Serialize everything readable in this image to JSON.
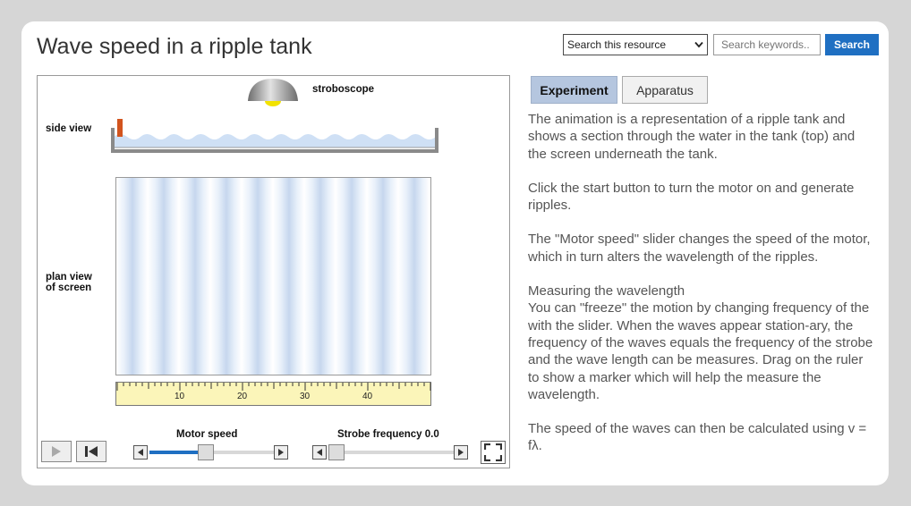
{
  "header": {
    "title": "Wave speed in a ripple tank",
    "search_select": "Search this resource",
    "search_placeholder": "Search keywords..",
    "search_button": "Search"
  },
  "simulation": {
    "stroboscope_label": "stroboscope",
    "side_view_label": "side view",
    "plan_view_label_1": "plan view",
    "plan_view_label_2": "of screen",
    "ruler_labels": [
      "10",
      "20",
      "30",
      "40"
    ],
    "motor_speed_label": "Motor speed",
    "strobe_frequency_label": "Strobe frequency 0.0",
    "motor_speed_level": 0.45,
    "strobe_frequency_level": 0.0
  },
  "tabs": [
    {
      "label": "Experiment",
      "active": true
    },
    {
      "label": "Apparatus",
      "active": false
    }
  ],
  "description": {
    "p1": "The animation is a representation of a ripple tank and shows a section through the water in the tank (top) and the screen underneath the tank.",
    "p2": "Click the start button to turn the motor on and generate ripples.",
    "p3": "The \"Motor speed\" slider changes the speed of the motor, which in turn alters the wavelength of the ripples.",
    "p4_heading": "Measuring the wavelength",
    "p4": "You can \"freeze\" the motion by changing frequency of the with the slider. When the waves appear station-ary, the frequency of the waves equals the frequency of the strobe and the wave length can be measures. Drag on the ruler to show a marker which will help the measure the wavelength.",
    "p5": "The speed of the waves can then be calculated using v = fλ."
  },
  "colors": {
    "accent": "#1f6fc2",
    "active_tab": "#b5c6df",
    "slider_fill": "#1f6fc2",
    "ruler": "#fbf5b9",
    "water": "#cfe0f5",
    "lamp": "#f2e200",
    "motor": "#d2541e"
  }
}
